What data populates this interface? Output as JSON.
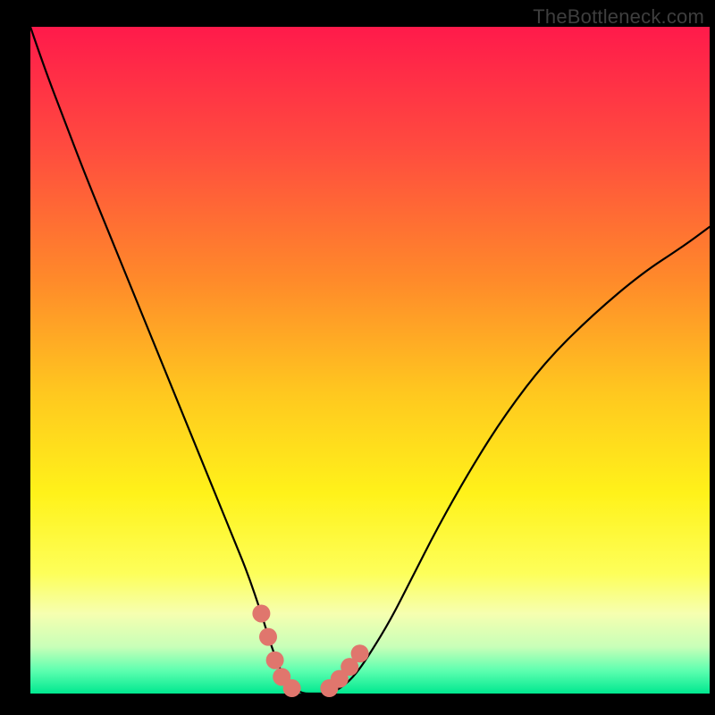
{
  "watermark": "TheBottleneck.com",
  "chart_data": {
    "type": "line",
    "title": "",
    "xlabel": "",
    "ylabel": "",
    "xlim": [
      0,
      100
    ],
    "ylim": [
      0,
      100
    ],
    "grid": false,
    "legend": false,
    "background_gradient": {
      "stops": [
        {
          "offset": 0.0,
          "color": "#ff1a4b"
        },
        {
          "offset": 0.18,
          "color": "#ff4b3f"
        },
        {
          "offset": 0.38,
          "color": "#ff8a2a"
        },
        {
          "offset": 0.55,
          "color": "#ffc81f"
        },
        {
          "offset": 0.7,
          "color": "#fff21a"
        },
        {
          "offset": 0.82,
          "color": "#fdff5a"
        },
        {
          "offset": 0.88,
          "color": "#f6ffb0"
        },
        {
          "offset": 0.93,
          "color": "#c8ffb8"
        },
        {
          "offset": 0.965,
          "color": "#5fffb0"
        },
        {
          "offset": 1.0,
          "color": "#00e890"
        }
      ]
    },
    "series": [
      {
        "name": "curve",
        "x": [
          0,
          2,
          5,
          8,
          12,
          16,
          20,
          24,
          28,
          30,
          32,
          34,
          35.5,
          37,
          38.5,
          40,
          42,
          44,
          46,
          48,
          50,
          53,
          56,
          60,
          65,
          70,
          76,
          83,
          90,
          96,
          100
        ],
        "y": [
          100,
          94,
          86,
          78,
          68,
          58,
          48,
          38,
          28,
          23,
          18,
          12,
          7,
          3,
          1,
          0,
          0,
          0,
          1,
          3,
          6,
          11,
          17,
          25,
          34,
          42,
          50,
          57,
          63,
          67,
          70
        ]
      }
    ],
    "highlight_points": {
      "name": "bottom-highlight",
      "color": "#e0766d",
      "radius_px": 10,
      "points_xy": [
        [
          34.0,
          12.0
        ],
        [
          35.0,
          8.5
        ],
        [
          36.0,
          5.0
        ],
        [
          37.0,
          2.5
        ],
        [
          38.5,
          0.8
        ],
        [
          44.0,
          0.8
        ],
        [
          45.5,
          2.2
        ],
        [
          47.0,
          4.0
        ],
        [
          48.5,
          6.0
        ]
      ]
    }
  }
}
